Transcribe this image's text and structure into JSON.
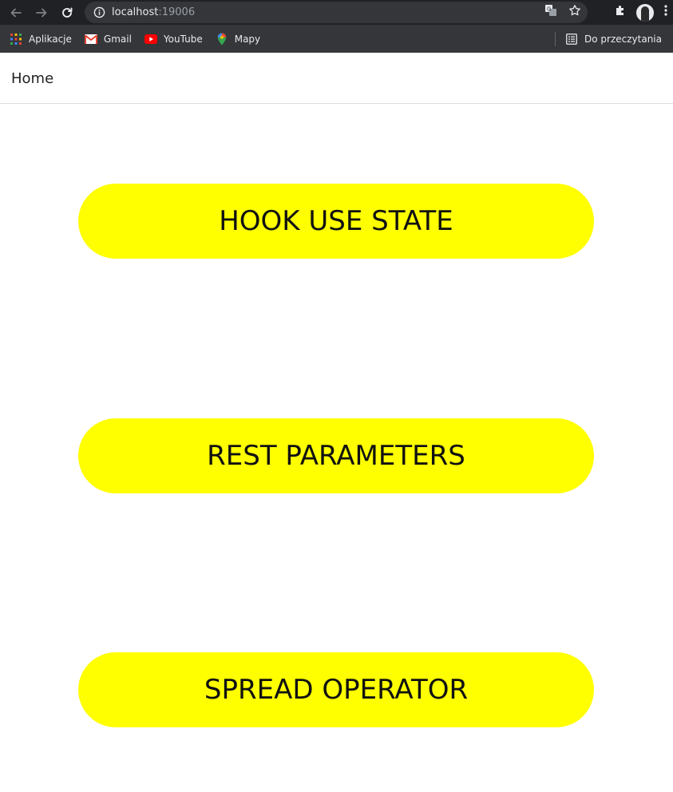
{
  "browser": {
    "url_host": "localhost",
    "url_port": ":19006",
    "icons": {
      "back": "arrow-left-icon",
      "forward": "arrow-right-icon",
      "reload": "reload-icon",
      "info": "info-icon",
      "translate": "translate-icon",
      "bookmark_star": "star-icon",
      "extensions": "puzzle-icon",
      "profile": "avatar",
      "menu": "kebab-menu-icon"
    },
    "bookmarks": [
      {
        "label": "Aplikacje",
        "icon": "apps-grid-icon"
      },
      {
        "label": "Gmail",
        "icon": "gmail-icon"
      },
      {
        "label": "YouTube",
        "icon": "youtube-icon"
      },
      {
        "label": "Mapy",
        "icon": "maps-pin-icon"
      }
    ],
    "reading_list_label": "Do przeczytania",
    "colors": {
      "toolbar_bg": "#202124",
      "bookmarks_bg": "#35363a",
      "text": "#e8eaed"
    }
  },
  "header": {
    "title": "Home"
  },
  "main": {
    "buttons": [
      {
        "label": "HOOK USE STATE"
      },
      {
        "label": "REST PARAMETERS"
      },
      {
        "label": "SPREAD OPERATOR"
      }
    ],
    "button_color": "#ffff00"
  }
}
